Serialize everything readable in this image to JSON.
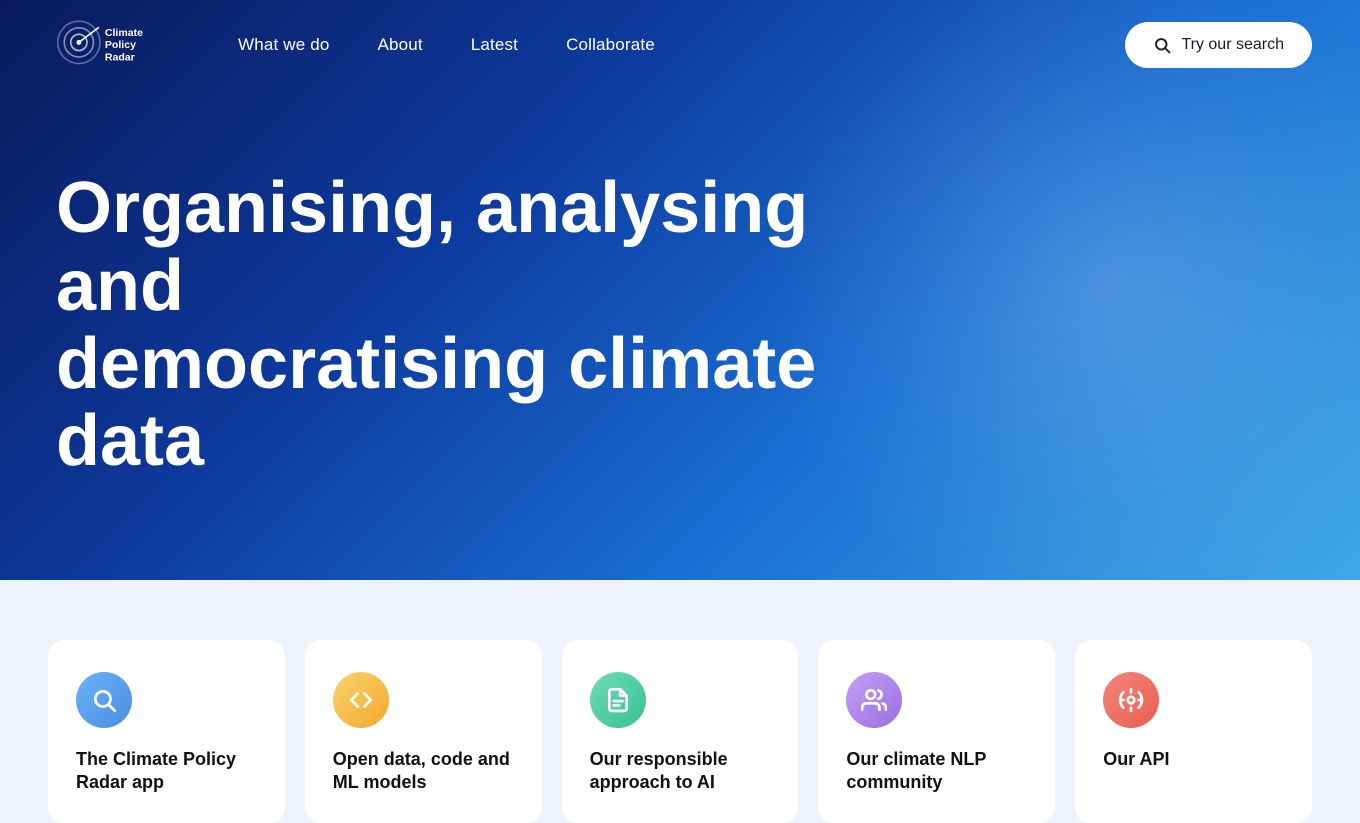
{
  "logo": {
    "alt": "Climate Policy Radar"
  },
  "nav": {
    "links": [
      {
        "label": "What we do",
        "href": "#"
      },
      {
        "label": "About",
        "href": "#"
      },
      {
        "label": "Latest",
        "href": "#"
      },
      {
        "label": "Collaborate",
        "href": "#"
      }
    ],
    "search_button": "Try our search"
  },
  "hero": {
    "heading_line1": "Organising, analysing and",
    "heading_line2": "democratising climate data"
  },
  "cards": [
    {
      "id": "climate-policy-radar-app",
      "icon": "search",
      "icon_style": "blue",
      "title": "The Climate Policy Radar app"
    },
    {
      "id": "open-data-code-ml",
      "icon": "code",
      "icon_style": "yellow",
      "title": "Open data, code and ML models"
    },
    {
      "id": "responsible-ai",
      "icon": "document",
      "icon_style": "teal",
      "title": "Our responsible approach to AI"
    },
    {
      "id": "climate-nlp-community",
      "icon": "people",
      "icon_style": "purple",
      "title": "Our climate NLP community"
    },
    {
      "id": "our-api",
      "icon": "api",
      "icon_style": "pink",
      "title": "Our API"
    }
  ],
  "icons": {
    "search": "🔍",
    "code": "⟨/⟩",
    "document": "📄",
    "people": "👥",
    "api": "⚙"
  }
}
